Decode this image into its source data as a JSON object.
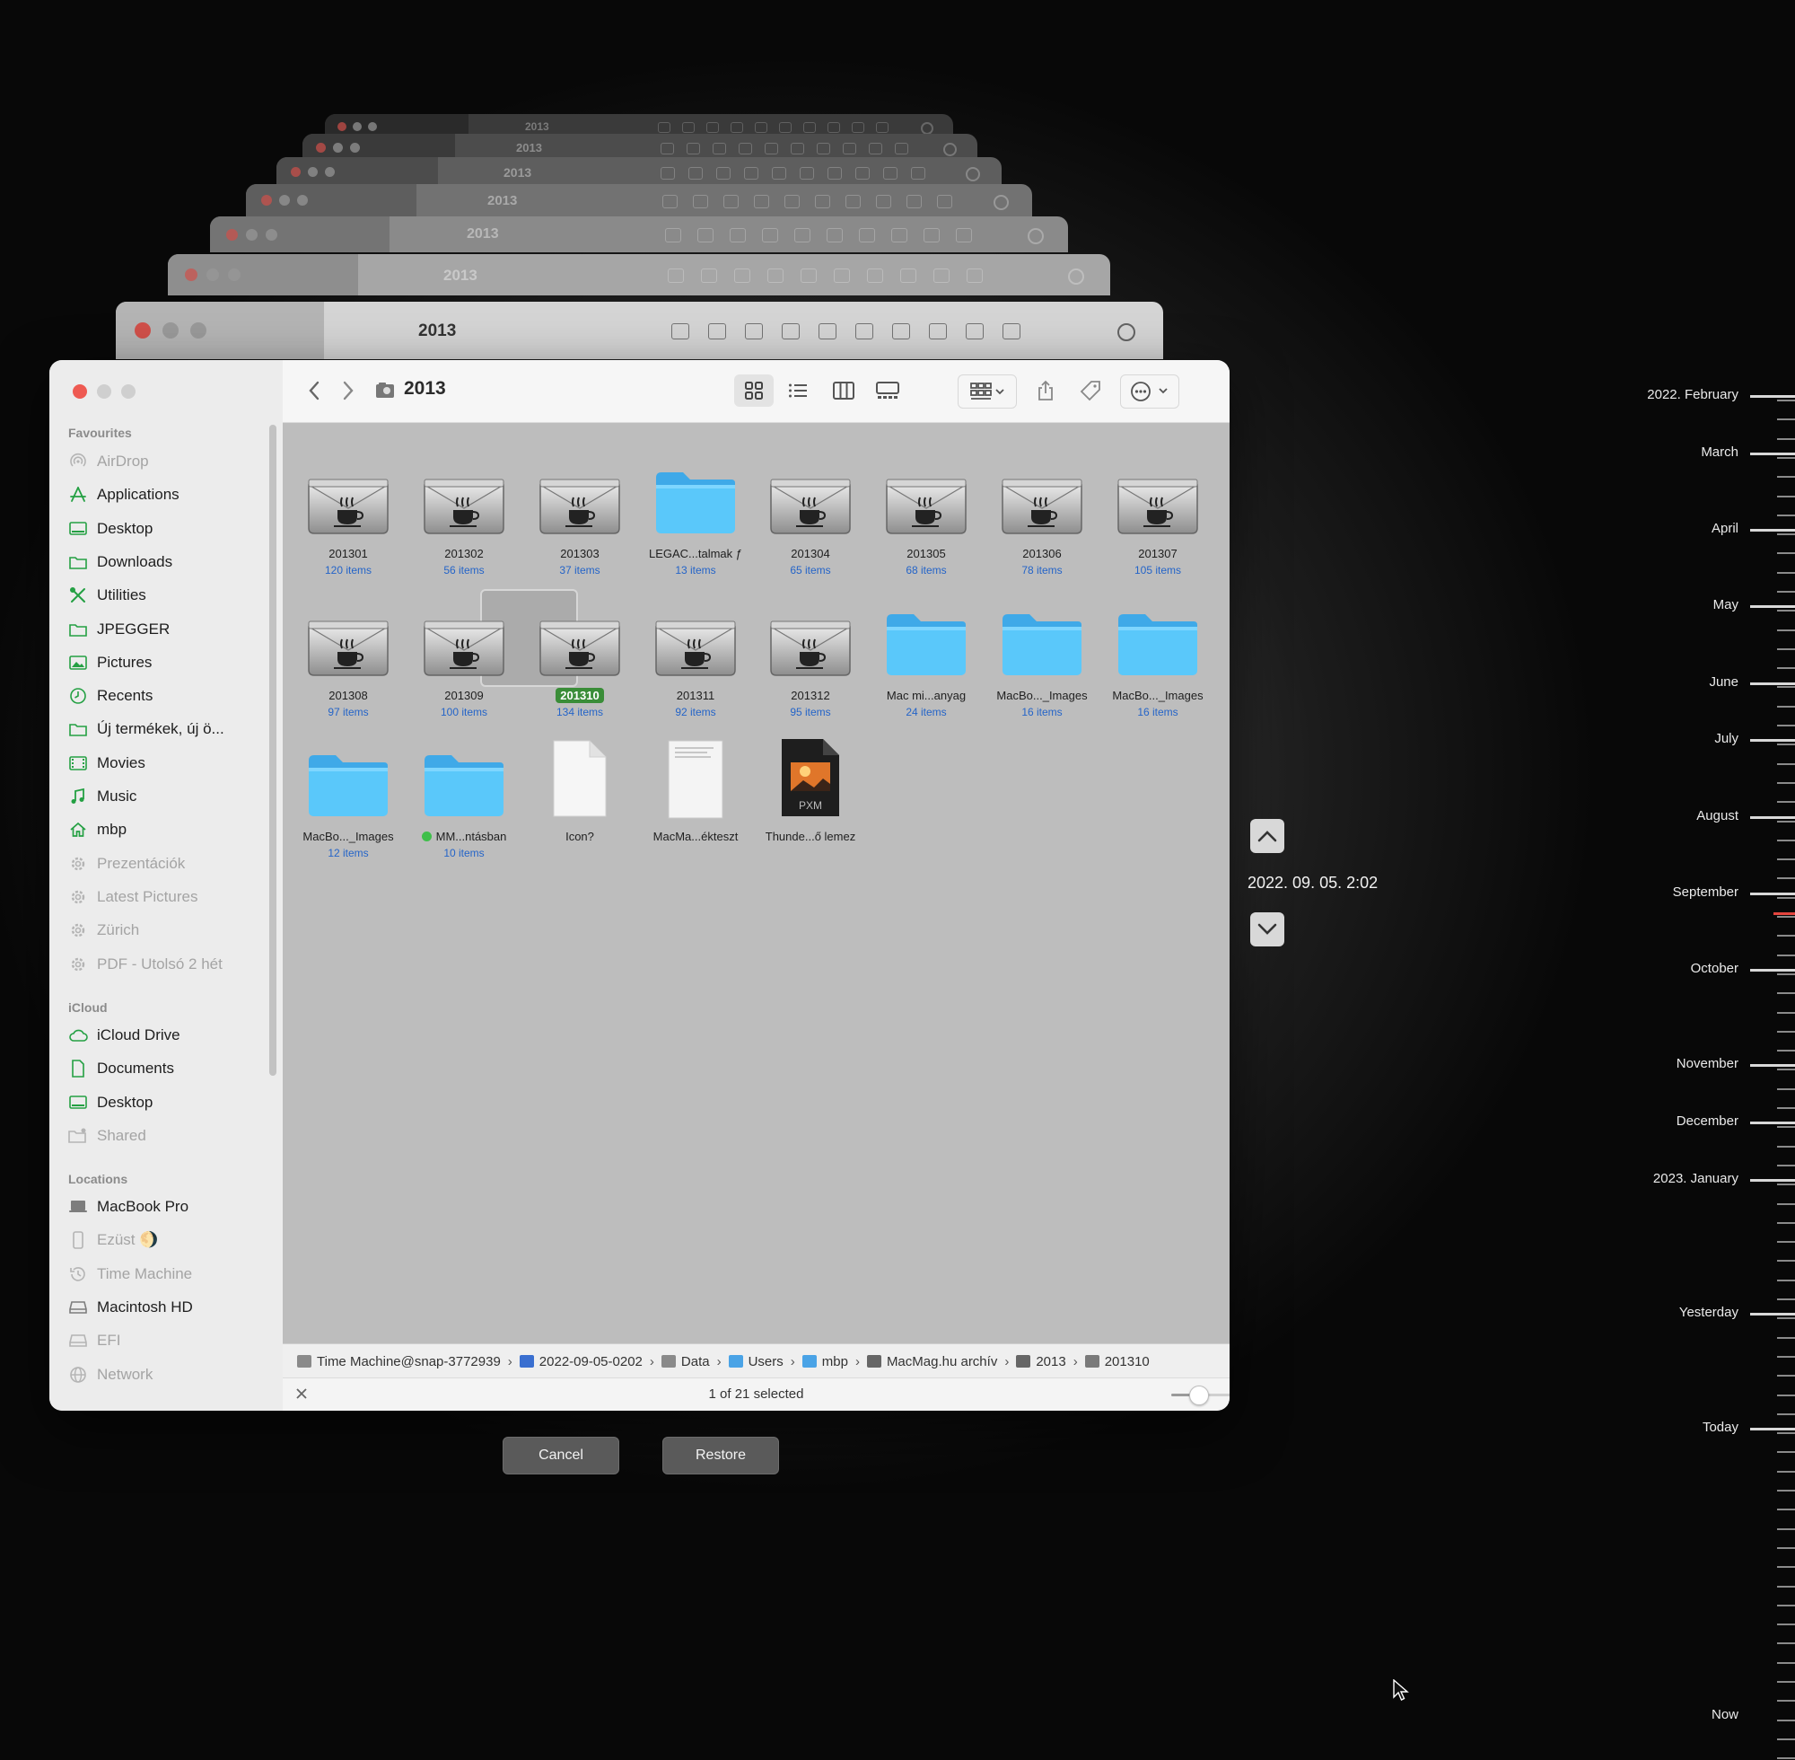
{
  "window": {
    "title": "2013"
  },
  "ghost_windows": {
    "title": "2013"
  },
  "sidebar": {
    "favourites_header": "Favourites",
    "favourites": [
      {
        "label": "AirDrop",
        "icon": "airdrop-icon",
        "dim": true
      },
      {
        "label": "Applications",
        "icon": "applications-icon",
        "dim": false
      },
      {
        "label": "Desktop",
        "icon": "desktop-icon",
        "dim": false
      },
      {
        "label": "Downloads",
        "icon": "folder-icon",
        "dim": false
      },
      {
        "label": "Utilities",
        "icon": "utilities-icon",
        "dim": false
      },
      {
        "label": "JPEGGER",
        "icon": "folder-icon",
        "dim": false
      },
      {
        "label": "Pictures",
        "icon": "pictures-icon",
        "dim": false
      },
      {
        "label": "Recents",
        "icon": "clock-icon",
        "dim": false
      },
      {
        "label": "Új termékek, új ö...",
        "icon": "folder-icon",
        "dim": false
      },
      {
        "label": "Movies",
        "icon": "movies-icon",
        "dim": false
      },
      {
        "label": "Music",
        "icon": "music-icon",
        "dim": false
      },
      {
        "label": "mbp",
        "icon": "home-icon",
        "dim": false
      },
      {
        "label": "Prezentációk",
        "icon": "gear-icon",
        "dim": true
      },
      {
        "label": "Latest Pictures",
        "icon": "gear-icon",
        "dim": true
      },
      {
        "label": "Zürich",
        "icon": "gear-icon",
        "dim": true
      },
      {
        "label": "PDF - Utolsó 2 hét",
        "icon": "gear-icon",
        "dim": true
      }
    ],
    "icloud_header": "iCloud",
    "icloud": [
      {
        "label": "iCloud Drive",
        "icon": "cloud-icon",
        "dim": false
      },
      {
        "label": "Documents",
        "icon": "document-icon",
        "dim": false
      },
      {
        "label": "Desktop",
        "icon": "desktop-icon",
        "dim": false
      },
      {
        "label": "Shared",
        "icon": "shared-folder-icon",
        "dim": true
      }
    ],
    "locations_header": "Locations",
    "locations": [
      {
        "label": "MacBook Pro",
        "icon": "laptop-icon",
        "dim": false
      },
      {
        "label": "Ezüst 🌖",
        "icon": "phone-icon",
        "dim": true
      },
      {
        "label": "Time Machine",
        "icon": "time-machine-icon",
        "dim": true
      },
      {
        "label": "Macintosh HD",
        "icon": "disk-icon",
        "dim": false
      },
      {
        "label": "EFI",
        "icon": "disk-icon",
        "dim": true
      },
      {
        "label": "Network",
        "icon": "network-icon",
        "dim": true
      }
    ]
  },
  "files": [
    {
      "name": "201301",
      "count": "120 items",
      "kind": "java"
    },
    {
      "name": "201302",
      "count": "56 items",
      "kind": "java"
    },
    {
      "name": "201303",
      "count": "37 items",
      "kind": "java"
    },
    {
      "name": "LEGAC...talmak ƒ",
      "count": "13 items",
      "kind": "folder"
    },
    {
      "name": "201304",
      "count": "65 items",
      "kind": "java"
    },
    {
      "name": "201305",
      "count": "68 items",
      "kind": "java"
    },
    {
      "name": "201306",
      "count": "78 items",
      "kind": "java"
    },
    {
      "name": "201307",
      "count": "105 items",
      "kind": "java"
    },
    {
      "name": "201308",
      "count": "97 items",
      "kind": "java"
    },
    {
      "name": "201309",
      "count": "100 items",
      "kind": "java"
    },
    {
      "name": "201310",
      "count": "134 items",
      "kind": "java",
      "selected": true
    },
    {
      "name": "201311",
      "count": "92 items",
      "kind": "java"
    },
    {
      "name": "201312",
      "count": "95 items",
      "kind": "java"
    },
    {
      "name": "Mac mi...anyag",
      "count": "24 items",
      "kind": "folder"
    },
    {
      "name": "MacBo..._Images",
      "count": "16 items",
      "kind": "folder"
    },
    {
      "name": "MacBo..._Images",
      "count": "16 items",
      "kind": "folder"
    },
    {
      "name": "MacBo..._Images",
      "count": "12 items",
      "kind": "folder"
    },
    {
      "name": "MM...ntásban",
      "count": "10 items",
      "kind": "folder",
      "tag": "#3fbf4a"
    },
    {
      "name": "Icon?",
      "count": "",
      "kind": "file"
    },
    {
      "name": "MacMa...ékteszt",
      "count": "",
      "kind": "document"
    },
    {
      "name": "Thunde...ő lemez",
      "count": "",
      "kind": "pxm"
    }
  ],
  "pxm_label": "PXM",
  "pathbar": [
    "Time Machine@snap-3772939",
    "2022-09-05-0202",
    "Data",
    "Users",
    "mbp",
    "MacMag.hu archív",
    "2013",
    "201310"
  ],
  "status": {
    "selection": "1 of 21 selected"
  },
  "buttons": {
    "cancel": "Cancel",
    "restore": "Restore"
  },
  "time_machine": {
    "current_date": "2022. 09. 05. 2:02"
  },
  "timeline": [
    "2022. February",
    "March",
    "April",
    "May",
    "June",
    "July",
    "August",
    "September",
    "October",
    "November",
    "December",
    "2023. January",
    "Yesterday",
    "Today",
    "Now"
  ],
  "colors": {
    "close": "#ee5a52",
    "selected_tag": "#3a8d38",
    "folder": "#5ac8fa",
    "count": "#2464c8"
  }
}
